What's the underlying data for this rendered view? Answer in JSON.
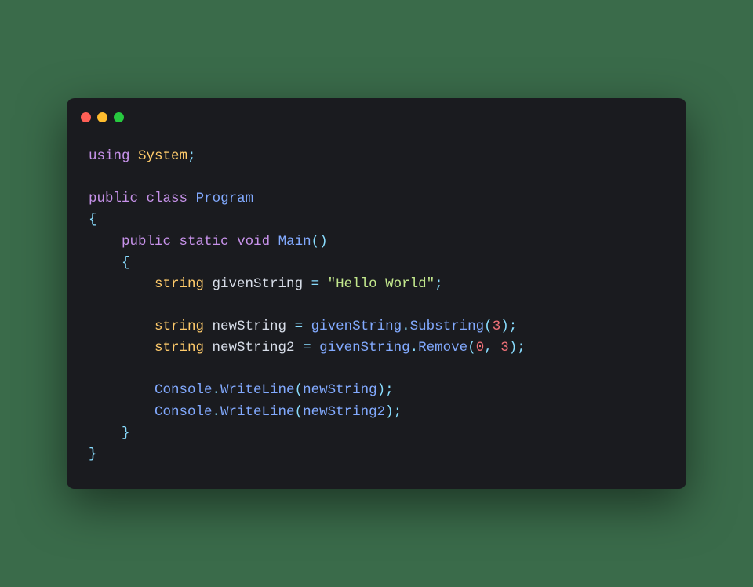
{
  "code": {
    "line1": {
      "using": "using",
      "system": "System",
      "semi": ";"
    },
    "line3": {
      "public": "public",
      "class": "class",
      "program": "Program"
    },
    "line4": {
      "brace": "{"
    },
    "line5": {
      "public": "public",
      "static": "static",
      "void": "void",
      "main": "Main",
      "parens": "()"
    },
    "line6": {
      "brace": "{"
    },
    "line7": {
      "string": "string",
      "var": "givenString",
      "eq": "=",
      "value": "\"Hello World\"",
      "semi": ";"
    },
    "line9": {
      "string": "string",
      "var": "newString",
      "eq": "=",
      "obj": "givenString",
      "dot": ".",
      "method": "Substring",
      "open": "(",
      "num": "3",
      "close": ")",
      "semi": ";"
    },
    "line10": {
      "string": "string",
      "var": "newString2",
      "eq": "=",
      "obj": "givenString",
      "dot": ".",
      "method": "Remove",
      "open": "(",
      "num1": "0",
      "comma": ",",
      "num2": "3",
      "close": ")",
      "semi": ";"
    },
    "line12": {
      "console": "Console",
      "dot": ".",
      "method": "WriteLine",
      "open": "(",
      "arg": "newString",
      "close": ")",
      "semi": ";"
    },
    "line13": {
      "console": "Console",
      "dot": ".",
      "method": "WriteLine",
      "open": "(",
      "arg": "newString2",
      "close": ")",
      "semi": ";"
    },
    "line14": {
      "brace": "}"
    },
    "line15": {
      "brace": "}"
    }
  }
}
